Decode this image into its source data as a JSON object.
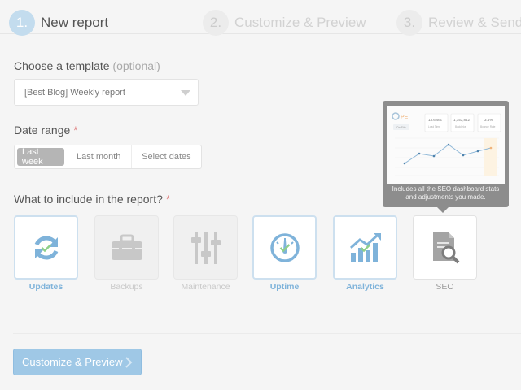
{
  "steps": [
    {
      "num": "1.",
      "label": "New report",
      "state": "active"
    },
    {
      "num": "2.",
      "label": "Customize & Preview",
      "state": "inactive"
    },
    {
      "num": "3.",
      "label": "Review & Send",
      "state": "inactive"
    }
  ],
  "template": {
    "label": "Choose a template",
    "optional": "(optional)",
    "value": "[Best Blog] Weekly report"
  },
  "date_range": {
    "label": "Date range",
    "required_mark": "*",
    "options": [
      "Last week",
      "Last month",
      "Select dates"
    ],
    "selected": "Last week"
  },
  "include": {
    "label": "What to include in the report?",
    "required_mark": "*",
    "items": [
      {
        "name": "Updates",
        "icon": "refresh-icon",
        "selected": true,
        "enabled": true
      },
      {
        "name": "Backups",
        "icon": "toolbox-icon",
        "selected": false,
        "enabled": false
      },
      {
        "name": "Maintenance",
        "icon": "sliders-icon",
        "selected": false,
        "enabled": false
      },
      {
        "name": "Uptime",
        "icon": "gauge-icon",
        "selected": true,
        "enabled": true
      },
      {
        "name": "Analytics",
        "icon": "bar-chart-icon",
        "selected": true,
        "enabled": true
      },
      {
        "name": "SEO",
        "icon": "document-search-icon",
        "selected": false,
        "enabled": true
      }
    ]
  },
  "tooltip": {
    "text": "Includes all the SEO dashboard stats and adjustments you made.",
    "preview": {
      "brand": "PE",
      "stats": [
        "13.6 sec",
        "1,153,842",
        "3.4%"
      ],
      "stat_labels": [
        "Load Time",
        "Backlinks",
        "Bounce Rate"
      ],
      "chip": "On Site"
    }
  },
  "actions": {
    "primary": "Customize & Preview"
  },
  "colors": {
    "accent": "#9fc8e6",
    "check": "#8ed08a",
    "tooltip_bg": "#8d8d8d",
    "required": "#e08585"
  }
}
